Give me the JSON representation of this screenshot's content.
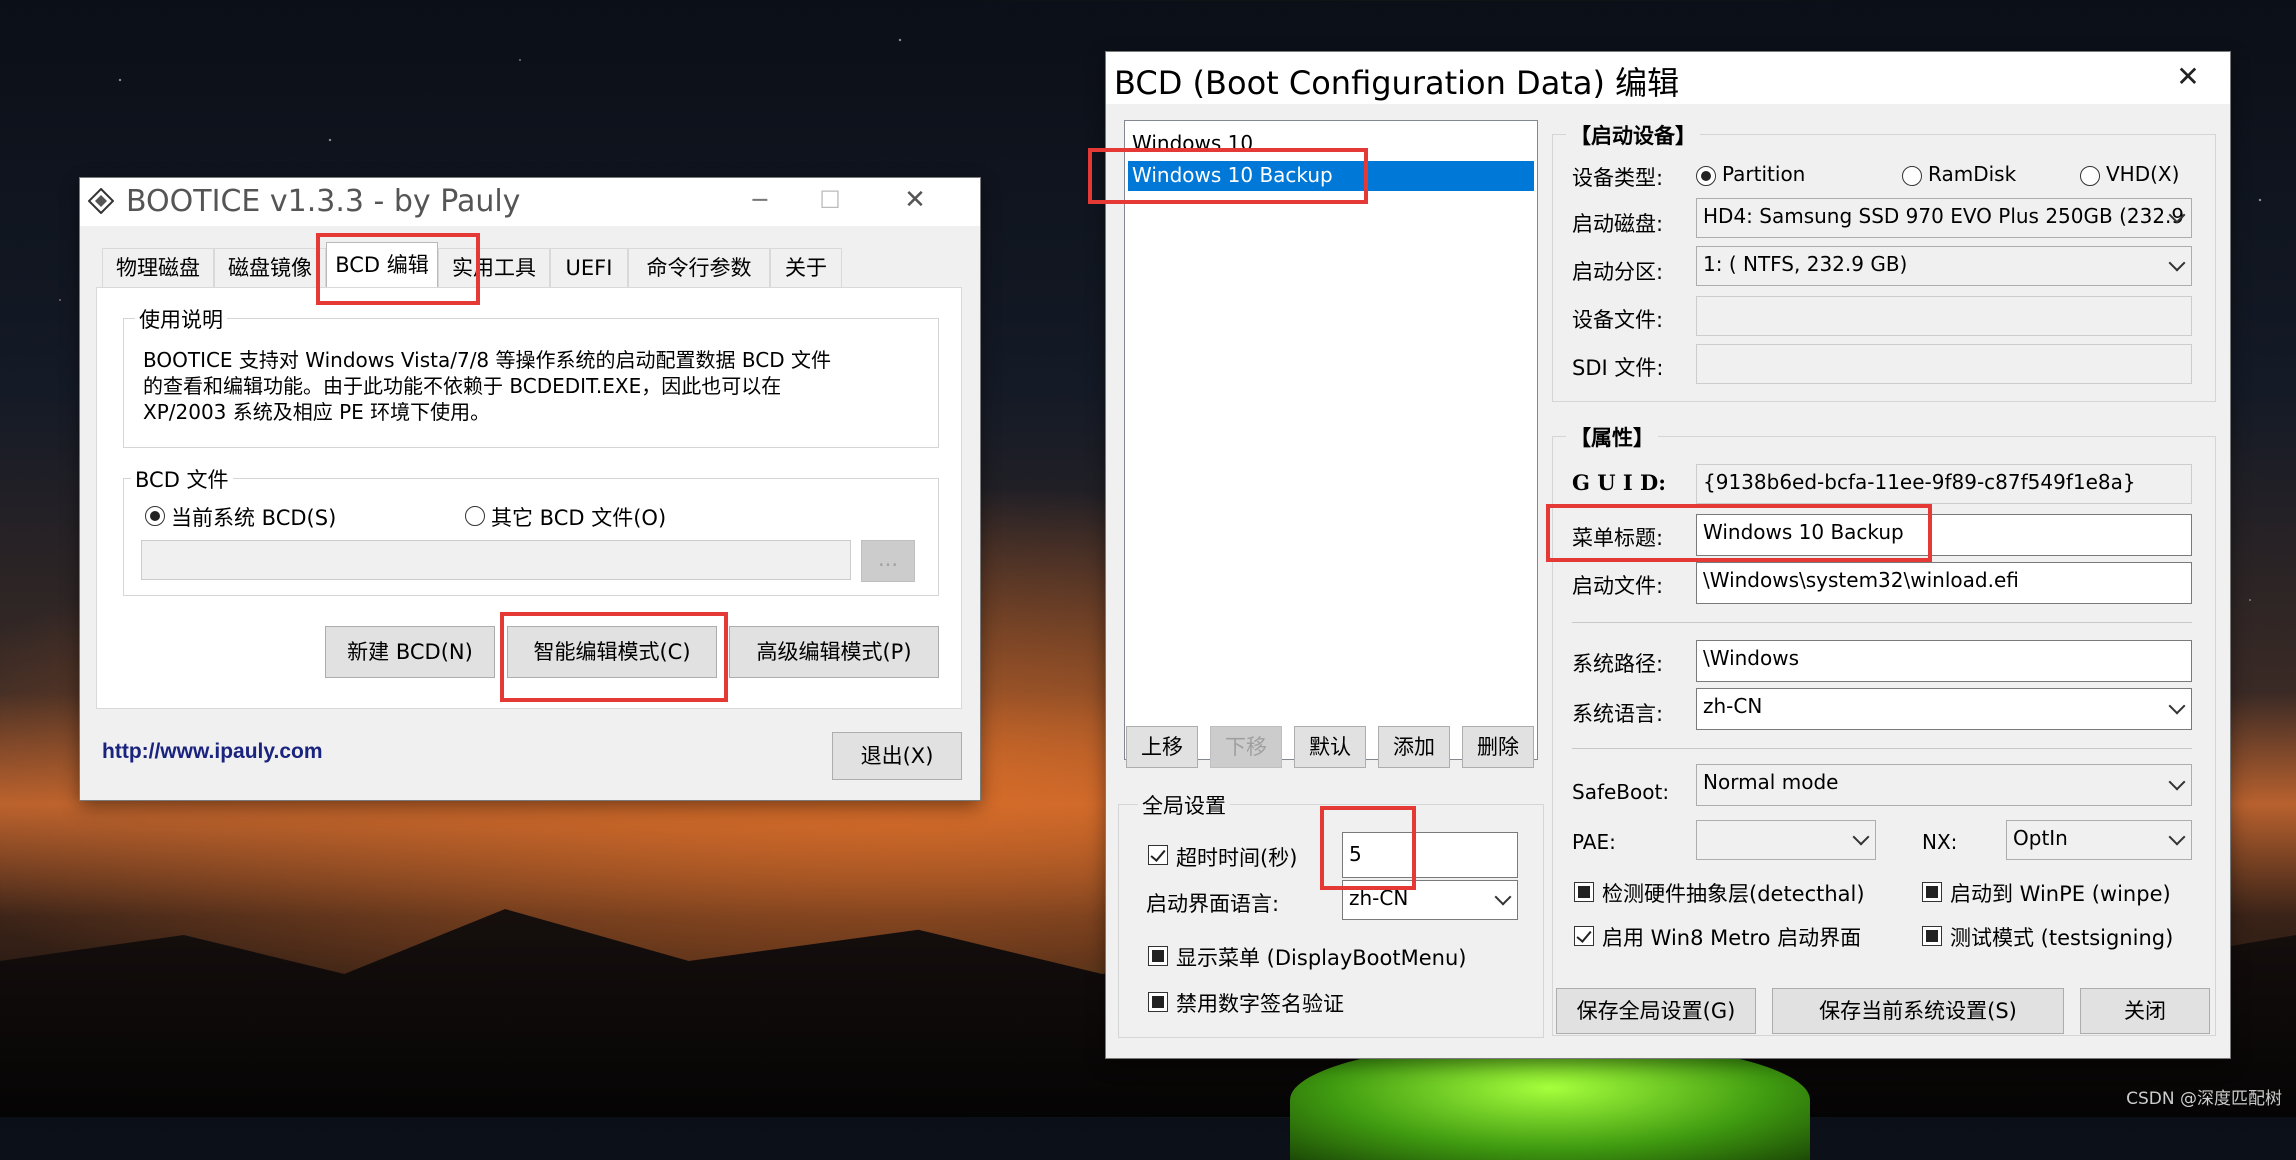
{
  "left_window": {
    "title": "BOOTICE v1.3.3 - by Pauly",
    "controls": {
      "minimize": "─",
      "maximize": "☐",
      "close": "✕"
    },
    "tabs": [
      "物理磁盘",
      "磁盘镜像",
      "BCD 编辑",
      "实用工具",
      "UEFI",
      "命令行参数",
      "关于"
    ],
    "active_tab": "BCD 编辑",
    "usage": {
      "title": "使用说明",
      "lines": [
        "BOOTICE 支持对 Windows Vista/7/8 等操作系统的启动配置数据 BCD 文件",
        "的查看和编辑功能。由于此功能不依赖于 BCDEDIT.EXE，因此也可以在",
        "XP/2003 系统及相应 PE 环境下使用。"
      ]
    },
    "bcd_file": {
      "title": "BCD 文件",
      "option_current": "当前系统 BCD(S)",
      "option_other": "其它 BCD 文件(O)",
      "path_value": "",
      "browse_label": "..."
    },
    "buttons": {
      "new_bcd": "新建 BCD(N)",
      "smart_edit": "智能编辑模式(C)",
      "advanced_edit": "高级编辑模式(P)",
      "exit": "退出(X)"
    },
    "link": "http://www.ipauly.com"
  },
  "right_window": {
    "title": "BCD (Boot Configuration Data) 编辑",
    "close": "✕",
    "entries": [
      {
        "label": "Windows 10",
        "selected": false
      },
      {
        "label": "Windows 10 Backup",
        "selected": true
      }
    ],
    "list_buttons": {
      "up": "上移",
      "down": "下移",
      "default": "默认",
      "add": "添加",
      "delete": "删除"
    },
    "global": {
      "title": "全局设置",
      "timeout_label": "超时时间(秒)",
      "timeout_value": "5",
      "boot_ui_lang_label": "启动界面语言:",
      "boot_ui_lang_value": "zh-CN",
      "show_menu": "显示菜单 (DisplayBootMenu)",
      "disable_sig": "禁用数字签名验证"
    },
    "boot_device": {
      "title": "【启动设备】",
      "type_label": "设备类型:",
      "type_partition": "Partition",
      "type_ramdisk": "RamDisk",
      "type_vhd": "VHD(X)",
      "disk_label": "启动磁盘:",
      "disk_value": "HD4: Samsung SSD 970 EVO Plus 250GB (232.9",
      "partition_label": "启动分区:",
      "partition_value": "1: ( NTFS, 232.9 GB)",
      "device_file_label": "设备文件:",
      "device_file_value": "",
      "sdi_file_label": "SDI 文件:",
      "sdi_file_value": ""
    },
    "attributes": {
      "title": "【属性】",
      "guid_label": "G U I D:",
      "guid_value": "{9138b6ed-bcfa-11ee-9f89-c87f549f1e8a}",
      "menu_title_label": "菜单标题:",
      "menu_title_value": "Windows 10 Backup",
      "boot_file_label": "启动文件:",
      "boot_file_value": "\\Windows\\system32\\winload.efi",
      "sys_path_label": "系统路径:",
      "sys_path_value": "\\Windows",
      "sys_lang_label": "系统语言:",
      "sys_lang_value": "zh-CN",
      "safeboot_label": "SafeBoot:",
      "safeboot_value": "Normal mode",
      "pae_label": "PAE:",
      "pae_value": "",
      "nx_label": "NX:",
      "nx_value": "OptIn",
      "detect_hal": "检测硬件抽象层(detecthal)",
      "winpe": "启动到 WinPE (winpe)",
      "metro": "启用 Win8 Metro 启动界面",
      "testsigning": "测试模式 (testsigning)"
    },
    "buttons": {
      "save_global": "保存全局设置(G)",
      "save_current": "保存当前系统设置(S)",
      "close": "关闭"
    }
  },
  "watermark": "CSDN @深度匹配树",
  "colors": {
    "highlight": "#e53935",
    "selection": "#0078d7",
    "link": "#1a237e"
  }
}
